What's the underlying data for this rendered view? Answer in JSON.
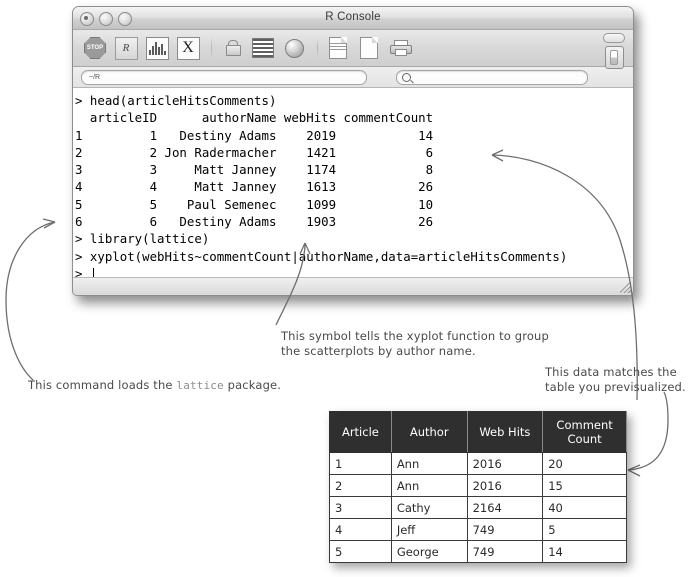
{
  "window": {
    "title": "R Console",
    "buttons": [
      "close",
      "minimize",
      "zoom"
    ],
    "path_field_value": "~/R",
    "search_placeholder": "",
    "toolbar_icons": [
      "stop-icon",
      "source-r-script-icon",
      "histogram-icon",
      "x11-device-icon",
      "lock-icon",
      "list-view-icon",
      "sphere-icon",
      "r-document-icon",
      "new-document-icon",
      "print-icon"
    ],
    "toolbar_right_icons": [
      "toolbar-pill-button",
      "panel-toggle-icon"
    ]
  },
  "console": {
    "lines": [
      "> head(articleHitsComments)",
      "  articleID      authorName webHits commentCount",
      "1         1   Destiny Adams    2019           14",
      "2         2 Jon Radermacher    1421            6",
      "3         3     Matt Janney    1174            8",
      "4         4     Matt Janney    1613           26",
      "5         5    Paul Semenec    1099           10",
      "6         6   Destiny Adams    1903           26",
      "> library(lattice)",
      "> xyplot(webHits~commentCount|authorName,data=articleHitsComments)",
      "> "
    ]
  },
  "annotations": {
    "group_symbol": {
      "line1": "This symbol tells the xyplot function to group",
      "line2": "the scatterplots by author name."
    },
    "library_command": {
      "prefix": "This command loads the ",
      "code": "lattice",
      "suffix": " package."
    },
    "table_match": {
      "line1": "This data matches the",
      "line2": "table you previsualized."
    }
  },
  "data_table": {
    "headers": [
      "Article",
      "Author",
      "Web Hits",
      "Comment Count"
    ],
    "header_comment_line1": "Comment",
    "header_comment_line2": "Count",
    "rows": [
      {
        "article": "1",
        "author": "Ann",
        "hits": "2016",
        "count": "20"
      },
      {
        "article": "2",
        "author": "Ann",
        "hits": "2016",
        "count": "15"
      },
      {
        "article": "3",
        "author": "Cathy",
        "hits": "2164",
        "count": "40"
      },
      {
        "article": "4",
        "author": "Jeff",
        "hits": "749",
        "count": "5"
      },
      {
        "article": "5",
        "author": "George",
        "hits": "749",
        "count": "14"
      }
    ]
  },
  "colors": {
    "table_header_bg": "#2f2f2f",
    "annotation_text": "#4a4a4a",
    "arrow": "#6e6e6e",
    "console_text": "#000000"
  }
}
